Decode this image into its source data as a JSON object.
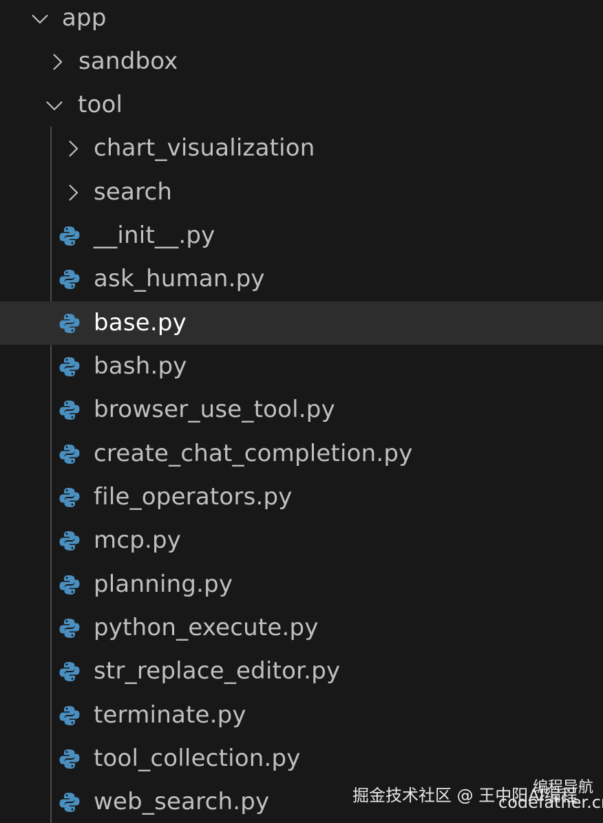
{
  "colors": {
    "background": "#181818",
    "selected_row": "#2d2d2e",
    "text": "#c0c0c0",
    "selected_text": "#ffffff",
    "python_blue": "#4a8fbf"
  },
  "tree": {
    "app": {
      "label": "app",
      "state": "expanded",
      "icon": "chevron-down-icon"
    },
    "sandbox": {
      "label": "sandbox",
      "state": "collapsed",
      "icon": "chevron-right-icon"
    },
    "tool": {
      "label": "tool",
      "state": "expanded",
      "icon": "chevron-down-icon"
    },
    "items": [
      {
        "label": "chart_visualization",
        "kind": "folder",
        "icon": "chevron-right-icon"
      },
      {
        "label": "search",
        "kind": "folder",
        "icon": "chevron-right-icon"
      },
      {
        "label": "__init__.py",
        "kind": "file",
        "icon": "python-icon"
      },
      {
        "label": "ask_human.py",
        "kind": "file",
        "icon": "python-icon"
      },
      {
        "label": "base.py",
        "kind": "file",
        "icon": "python-icon",
        "selected": true
      },
      {
        "label": "bash.py",
        "kind": "file",
        "icon": "python-icon"
      },
      {
        "label": "browser_use_tool.py",
        "kind": "file",
        "icon": "python-icon"
      },
      {
        "label": "create_chat_completion.py",
        "kind": "file",
        "icon": "python-icon"
      },
      {
        "label": "file_operators.py",
        "kind": "file",
        "icon": "python-icon"
      },
      {
        "label": "mcp.py",
        "kind": "file",
        "icon": "python-icon"
      },
      {
        "label": "planning.py",
        "kind": "file",
        "icon": "python-icon"
      },
      {
        "label": "python_execute.py",
        "kind": "file",
        "icon": "python-icon"
      },
      {
        "label": "str_replace_editor.py",
        "kind": "file",
        "icon": "python-icon"
      },
      {
        "label": "terminate.py",
        "kind": "file",
        "icon": "python-icon"
      },
      {
        "label": "tool_collection.py",
        "kind": "file",
        "icon": "python-icon"
      },
      {
        "label": "web_search.py",
        "kind": "file",
        "icon": "python-icon"
      }
    ]
  },
  "watermark": {
    "left": "掘金技术社区 @ 王中阳AI编程",
    "right_top": "编程导航",
    "right_bottom": "codefather.cn"
  }
}
